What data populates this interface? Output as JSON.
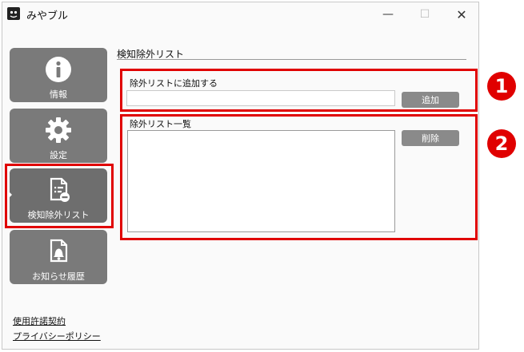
{
  "window": {
    "title": "みやブル"
  },
  "controls": {
    "minimize": "—",
    "maximize": "☐",
    "close": "✕"
  },
  "sidebar": {
    "items": [
      {
        "label": "情報",
        "icon": "info-icon"
      },
      {
        "label": "設定",
        "icon": "gear-icon"
      },
      {
        "label": "検知除外リスト",
        "icon": "document-minus-icon",
        "selected": true
      },
      {
        "label": "お知らせ履歴",
        "icon": "document-bell-icon"
      }
    ],
    "links": [
      "使用許諾契約",
      "プライバシーポリシー"
    ]
  },
  "main": {
    "section_title": "検知除外リスト",
    "add_group": {
      "label": "除外リストに追加する",
      "input_value": "",
      "button": "追加"
    },
    "list_group": {
      "label": "除外リスト一覧",
      "button": "削除",
      "items": []
    }
  },
  "annotations": {
    "badge1": "1",
    "badge2": "2",
    "color": "#e00000"
  }
}
